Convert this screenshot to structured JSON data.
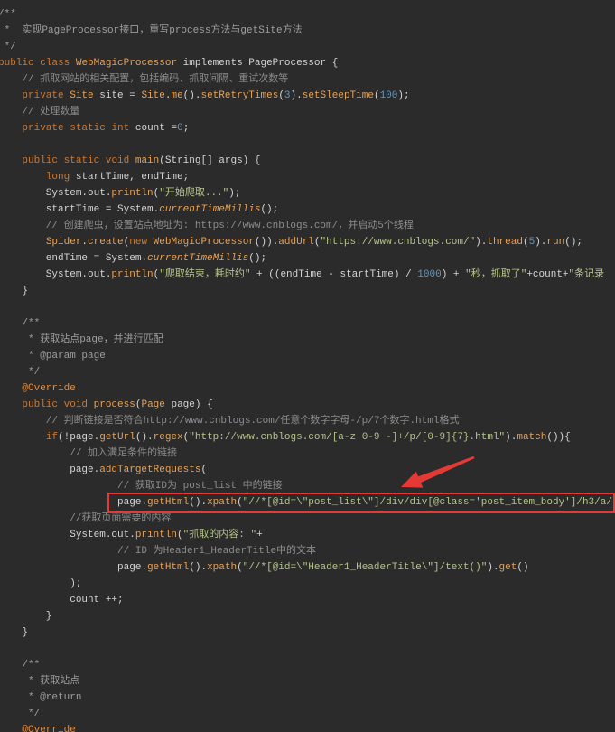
{
  "editor": {
    "palette": [
      "#d4d4d4",
      "#cc7832",
      "#e6a157",
      "#8c8c8c",
      "#b5c48a",
      "#6897bb",
      "#e08c40",
      "#e6a157",
      "#9e9e9e"
    ],
    "lines": [
      [
        [
          "/**",
          8
        ]
      ],
      [
        [
          " *  实现PageProcessor接口，重写process方法与getSite方法",
          8
        ]
      ],
      [
        [
          " */",
          8
        ]
      ],
      [
        [
          "public",
          1
        ],
        [
          " ",
          0
        ],
        [
          "class",
          1
        ],
        [
          " ",
          0
        ],
        [
          "WebMagicProcessor",
          2
        ],
        [
          " implements PageProcessor {",
          0
        ]
      ],
      [
        [
          "    // 抓取网站的相关配置，包括编码、抓取间隔、重试次数等",
          3
        ]
      ],
      [
        [
          "    ",
          0
        ],
        [
          "private",
          1
        ],
        [
          " ",
          0
        ],
        [
          "Site",
          2
        ],
        [
          " site = ",
          0
        ],
        [
          "Site",
          2
        ],
        [
          ".",
          0
        ],
        [
          "me",
          2
        ],
        [
          "().",
          0
        ],
        [
          "setRetryTimes",
          2
        ],
        [
          "(",
          0
        ],
        [
          "3",
          5
        ],
        [
          ").",
          0
        ],
        [
          "setSleepTime",
          2
        ],
        [
          "(",
          0
        ],
        [
          "100",
          5
        ],
        [
          ");",
          0
        ]
      ],
      [
        [
          "    // 处理数量",
          3
        ]
      ],
      [
        [
          "    ",
          0
        ],
        [
          "private",
          1
        ],
        [
          " ",
          0
        ],
        [
          "static",
          1
        ],
        [
          " ",
          0
        ],
        [
          "int",
          1
        ],
        [
          " count =",
          0
        ],
        [
          "0",
          5
        ],
        [
          ";",
          0
        ]
      ],
      [],
      [
        [
          "    ",
          0
        ],
        [
          "public",
          1
        ],
        [
          " ",
          0
        ],
        [
          "static",
          1
        ],
        [
          " ",
          0
        ],
        [
          "void",
          1
        ],
        [
          " ",
          0
        ],
        [
          "main",
          2
        ],
        [
          "(String[] args) {",
          0
        ]
      ],
      [
        [
          "        ",
          0
        ],
        [
          "long",
          1
        ],
        [
          " startTime, endTime;",
          0
        ]
      ],
      [
        [
          "        System.out.",
          0
        ],
        [
          "println",
          2
        ],
        [
          "(",
          0
        ],
        [
          "\"开始爬取...\"",
          4
        ],
        [
          ");",
          0
        ]
      ],
      [
        [
          "        startTime = System.",
          0
        ],
        [
          "currentTimeMillis",
          7
        ],
        [
          "();",
          0
        ]
      ],
      [
        [
          "        // 创建爬虫，设置站点地址为: https://www.cnblogs.com/，并启动5个线程",
          3
        ]
      ],
      [
        [
          "        ",
          0
        ],
        [
          "Spider",
          2
        ],
        [
          ".",
          0
        ],
        [
          "create",
          2
        ],
        [
          "(",
          0
        ],
        [
          "new",
          1
        ],
        [
          " ",
          0
        ],
        [
          "WebMagicProcessor",
          2
        ],
        [
          "()).",
          0
        ],
        [
          "addUrl",
          2
        ],
        [
          "(",
          0
        ],
        [
          "\"https://www.cnblogs.com/\"",
          4
        ],
        [
          ").",
          0
        ],
        [
          "thread",
          2
        ],
        [
          "(",
          0
        ],
        [
          "5",
          5
        ],
        [
          ").",
          0
        ],
        [
          "run",
          2
        ],
        [
          "();",
          0
        ]
      ],
      [
        [
          "        endTime = System.",
          0
        ],
        [
          "currentTimeMillis",
          7
        ],
        [
          "();",
          0
        ]
      ],
      [
        [
          "        System.out.",
          0
        ],
        [
          "println",
          2
        ],
        [
          "(",
          0
        ],
        [
          "\"爬取结束，耗时约\"",
          4
        ],
        [
          " + ((endTime - startTime) / ",
          0
        ],
        [
          "1000",
          5
        ],
        [
          ") + ",
          0
        ],
        [
          "\"秒，抓取了\"",
          4
        ],
        [
          "+count+",
          0
        ],
        [
          "\"条记录",
          4
        ]
      ],
      [
        [
          "    }",
          0
        ]
      ],
      [],
      [
        [
          "    /**",
          8
        ]
      ],
      [
        [
          "     * 获取站点page，并进行匹配",
          8
        ]
      ],
      [
        [
          "     * @param page",
          8
        ]
      ],
      [
        [
          "     */",
          8
        ]
      ],
      [
        [
          "    ",
          0
        ],
        [
          "@Override",
          6
        ]
      ],
      [
        [
          "    ",
          0
        ],
        [
          "public",
          1
        ],
        [
          " ",
          0
        ],
        [
          "void",
          1
        ],
        [
          " ",
          0
        ],
        [
          "process",
          2
        ],
        [
          "(",
          0
        ],
        [
          "Page",
          2
        ],
        [
          " page) {",
          0
        ]
      ],
      [
        [
          "        // 判断链接是否符合http://www.cnblogs.com/任意个数字字母-/p/7个数字.html格式",
          3
        ]
      ],
      [
        [
          "        ",
          0
        ],
        [
          "if",
          1
        ],
        [
          "(!page.",
          0
        ],
        [
          "getUrl",
          2
        ],
        [
          "().",
          0
        ],
        [
          "regex",
          2
        ],
        [
          "(",
          0
        ],
        [
          "\"http://www.cnblogs.com/[a-z 0-9 -]+/p/[0-9]{7}.html\"",
          4
        ],
        [
          ").",
          0
        ],
        [
          "match",
          2
        ],
        [
          "()){",
          0
        ]
      ],
      [
        [
          "            // 加入满足条件的链接",
          3
        ]
      ],
      [
        [
          "            page.",
          0
        ],
        [
          "addTargetRequests",
          2
        ],
        [
          "(",
          0
        ]
      ],
      [
        [
          "                    // 获取ID为 post_list 中的链接",
          3
        ]
      ],
      [
        [
          "                    page.",
          0
        ],
        [
          "getHtml",
          2
        ],
        [
          "().",
          0
        ],
        [
          "xpath",
          2
        ],
        [
          "(",
          0
        ],
        [
          "\"//*[@id=\\\"post_list\\\"]/div/div[@class='post_item_body']/h3/a/",
          4
        ]
      ],
      [
        [
          "            //获取页面需要的内容",
          3
        ]
      ],
      [
        [
          "            System.out.",
          0
        ],
        [
          "println",
          2
        ],
        [
          "(",
          0
        ],
        [
          "\"抓取的内容: \"",
          4
        ],
        [
          "+",
          0
        ]
      ],
      [
        [
          "                    // ID 为Header1_HeaderTitle中的文本",
          3
        ]
      ],
      [
        [
          "                    page.",
          0
        ],
        [
          "getHtml",
          2
        ],
        [
          "().",
          0
        ],
        [
          "xpath",
          2
        ],
        [
          "(",
          0
        ],
        [
          "\"//*[@id=\\\"Header1_HeaderTitle\\\"]/text()\"",
          4
        ],
        [
          ").",
          0
        ],
        [
          "get",
          2
        ],
        [
          "()",
          0
        ]
      ],
      [
        [
          "            );",
          0
        ]
      ],
      [
        [
          "            count ++;",
          0
        ]
      ],
      [
        [
          "        }",
          0
        ]
      ],
      [
        [
          "    }",
          0
        ]
      ],
      [],
      [
        [
          "    /**",
          8
        ]
      ],
      [
        [
          "     * 获取站点",
          8
        ]
      ],
      [
        [
          "     * @return",
          8
        ]
      ],
      [
        [
          "     */",
          8
        ]
      ],
      [
        [
          "    ",
          0
        ],
        [
          "@Override",
          6
        ]
      ]
    ]
  },
  "annotation": {
    "color": "#e53935"
  }
}
